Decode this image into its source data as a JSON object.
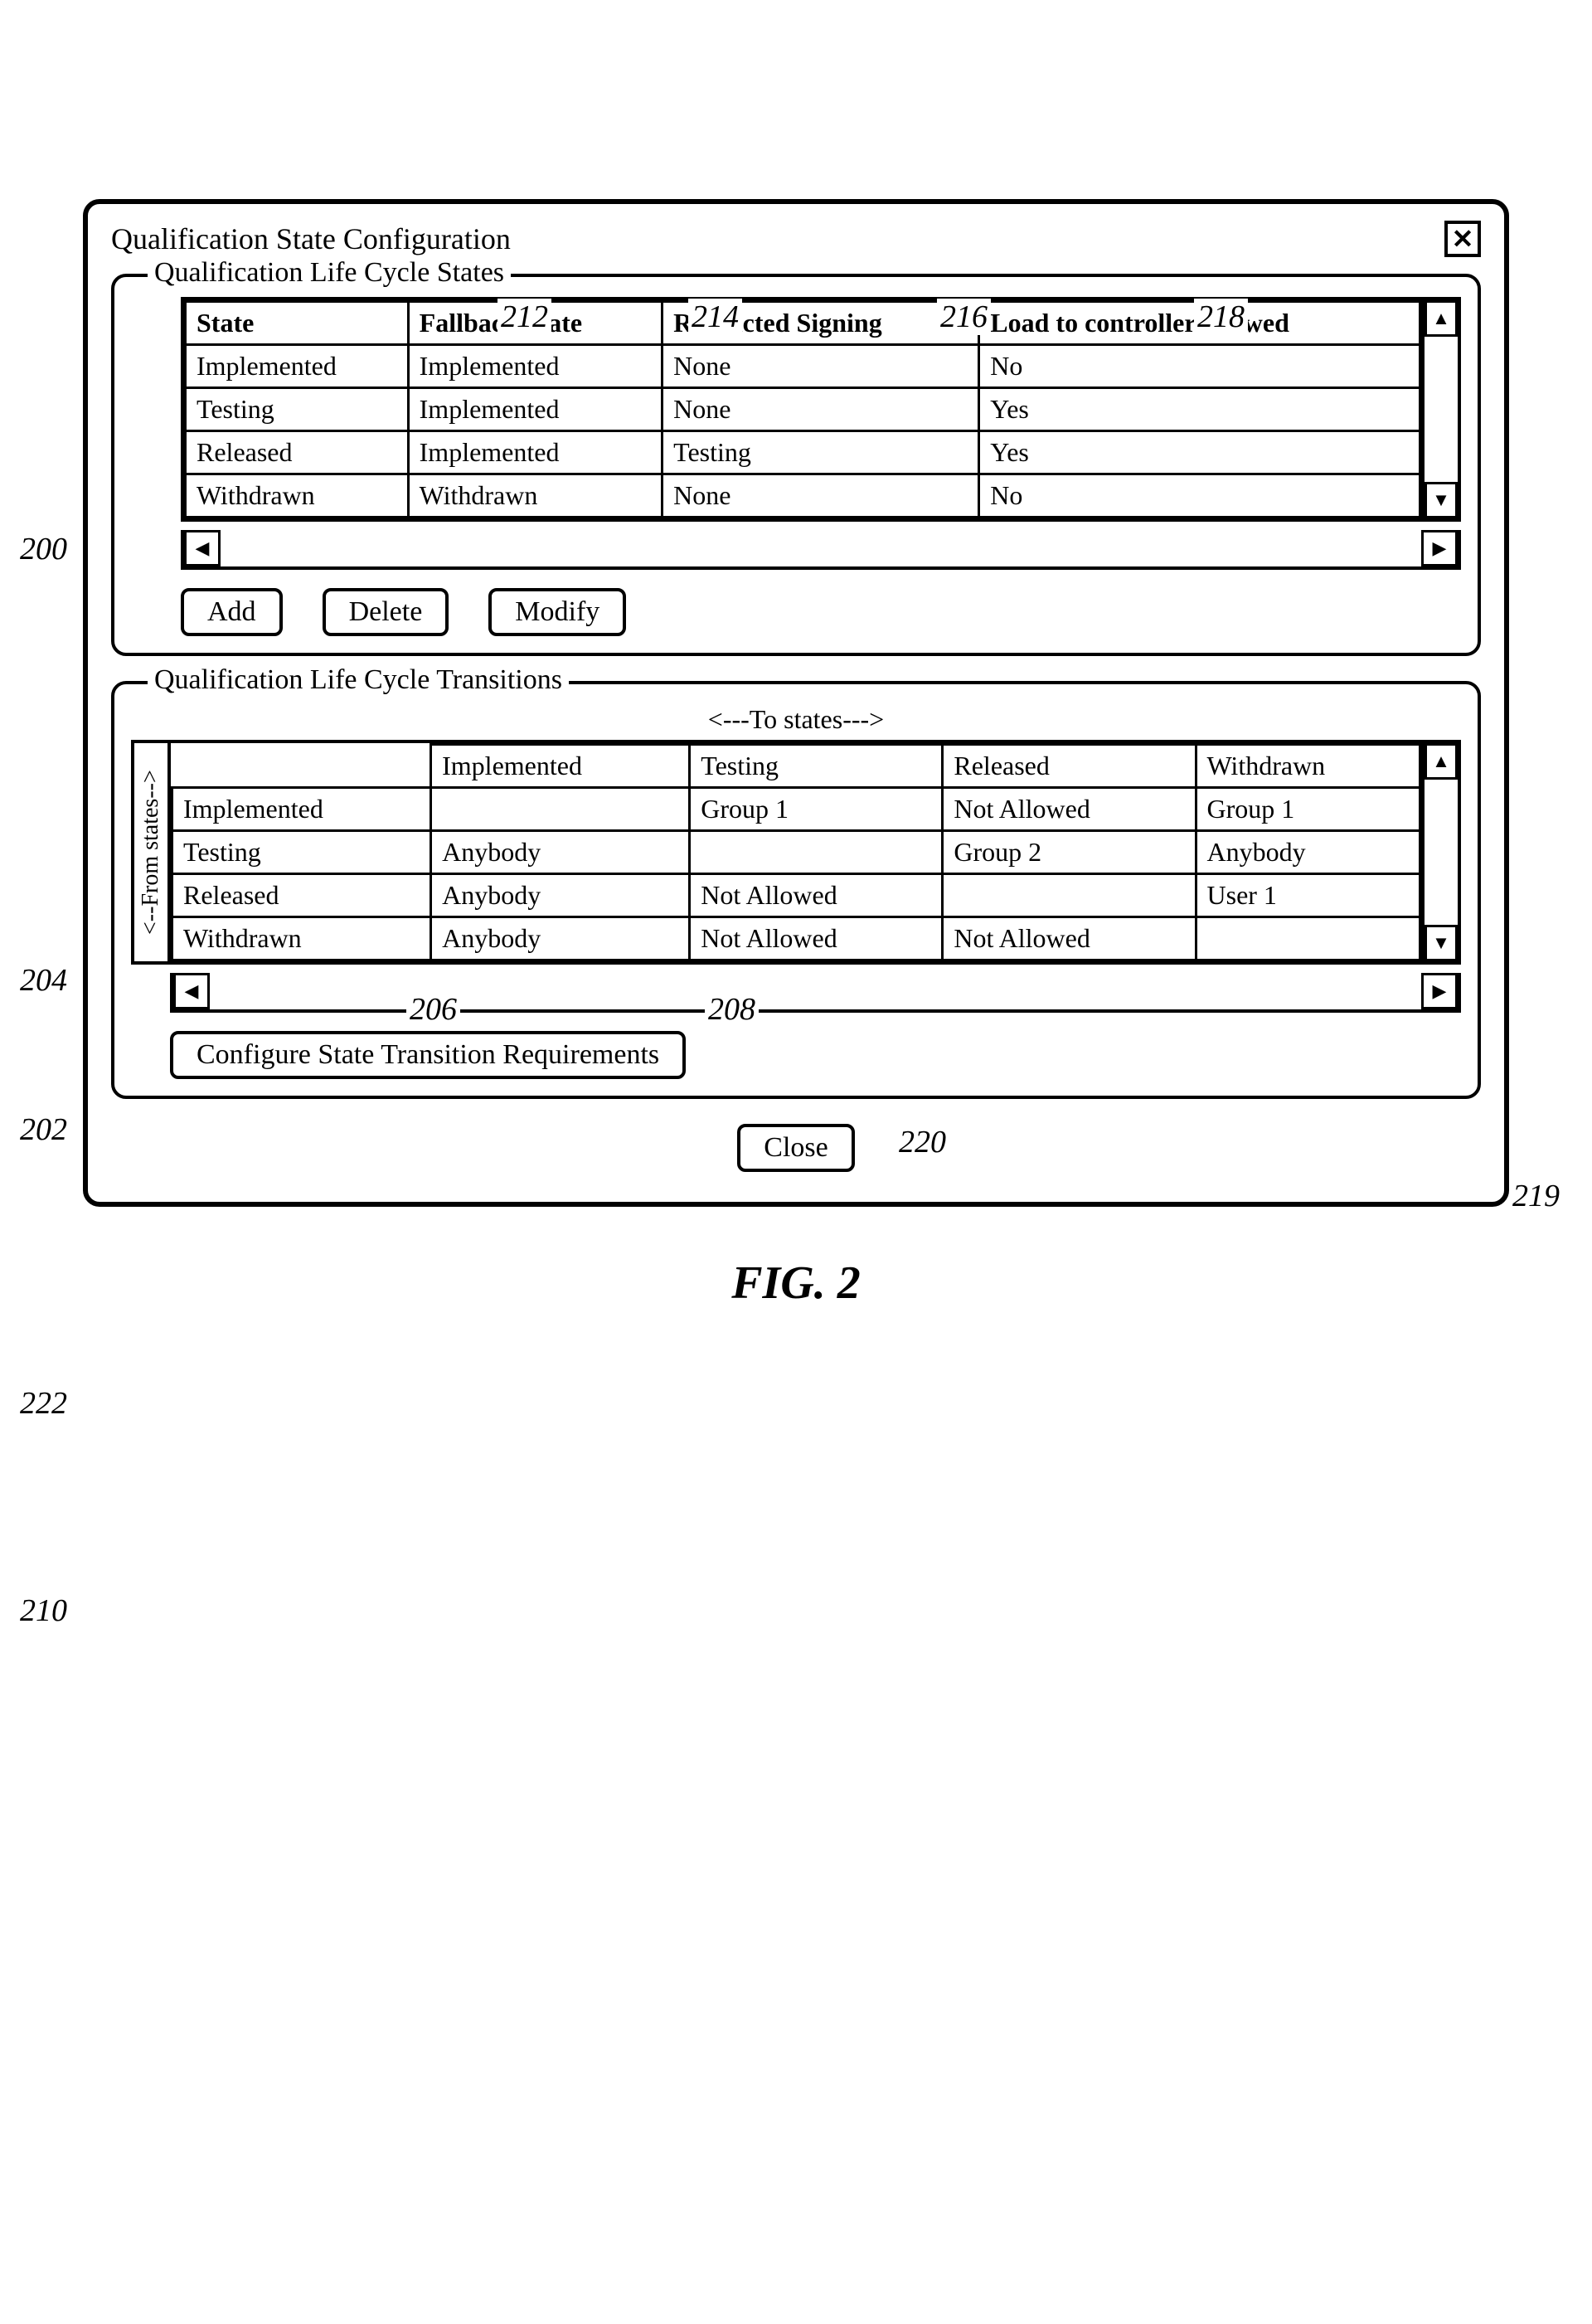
{
  "figure_label": "FIG. 2",
  "window_title": "Qualification State Configuration",
  "close_glyph": "✕",
  "states_box": {
    "legend": "Qualification Life Cycle States",
    "headers": [
      "State",
      "Fallback State",
      "Restricted Signing",
      "Load to controller allowed"
    ],
    "rows": [
      [
        "Implemented",
        "Implemented",
        "None",
        "No"
      ],
      [
        "Testing",
        "Implemented",
        "None",
        "Yes"
      ],
      [
        "Released",
        "Implemented",
        "Testing",
        "Yes"
      ],
      [
        "Withdrawn",
        "Withdrawn",
        "None",
        "No"
      ]
    ],
    "buttons": {
      "add": "Add",
      "del": "Delete",
      "mod": "Modify"
    }
  },
  "trans_box": {
    "legend": "Qualification Life Cycle Transitions",
    "to_states_label": "<---To states--->",
    "from_states_label": "<--From states-->",
    "col_headers": [
      "Implemented",
      "Testing",
      "Released",
      "Withdrawn"
    ],
    "rows": [
      {
        "name": "Implemented",
        "cells": [
          "",
          "Group 1",
          "Not Allowed",
          "Group 1"
        ]
      },
      {
        "name": "Testing",
        "cells": [
          "Anybody",
          "",
          "Group 2",
          "Anybody"
        ]
      },
      {
        "name": "Released",
        "cells": [
          "Anybody",
          "Not Allowed",
          "",
          "User 1"
        ]
      },
      {
        "name": "Withdrawn",
        "cells": [
          "Anybody",
          "Not Allowed",
          "Not Allowed",
          ""
        ]
      }
    ],
    "config_btn": "Configure State Transition Requirements"
  },
  "close_btn": "Close",
  "callouts": {
    "c200": "200",
    "c202": "202",
    "c204": "204",
    "c206": "206",
    "c208": "208",
    "c210": "210",
    "c212": "212",
    "c214": "214",
    "c216": "216",
    "c218": "218",
    "c219": "219",
    "c220": "220",
    "c222": "222"
  },
  "arrows": {
    "up": "▲",
    "down": "▼",
    "left": "◀",
    "right": "▶"
  }
}
